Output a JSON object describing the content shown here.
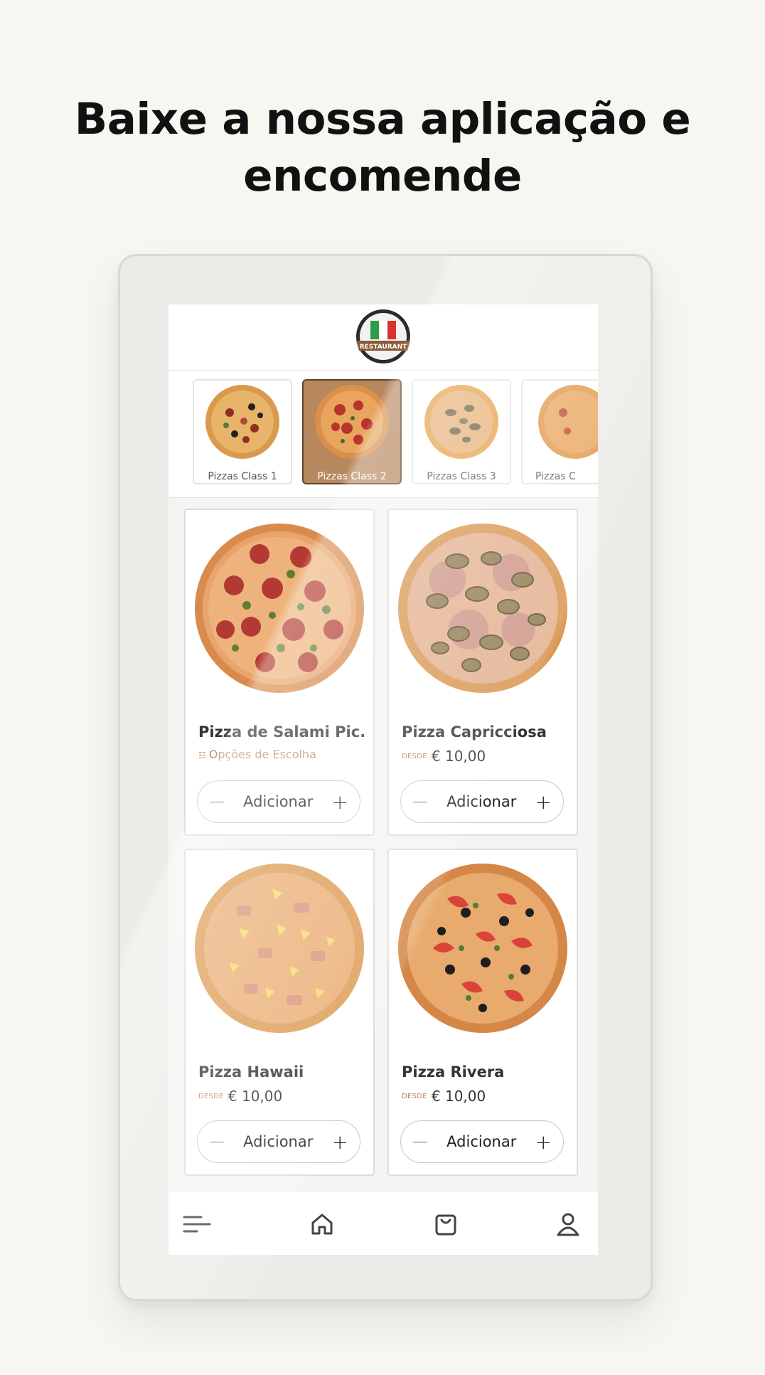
{
  "headline": {
    "line1": "Baixe a nossa aplicação e",
    "line2": "encomende"
  },
  "app": {
    "logo_text": "RESTAURANT",
    "categories": [
      {
        "label": "Pizzas Class 1",
        "active": false
      },
      {
        "label": "Pizzas Class 2",
        "active": true
      },
      {
        "label": "Pizzas Class 3",
        "active": false
      },
      {
        "label": "Pizzas C",
        "active": false
      }
    ],
    "products": [
      {
        "name": "Pizza de Salami Pic...",
        "options_label": "Opções de Escolha",
        "add_label": "Adicionar"
      },
      {
        "name": "Pizza Capricciosa",
        "desde": "DESDE",
        "price": "€ 10,00",
        "add_label": "Adicionar"
      },
      {
        "name": "Pizza Hawaii",
        "desde": "DESDE",
        "price": "€ 10,00",
        "add_label": "Adicionar"
      },
      {
        "name": "Pizza Rivera",
        "desde": "DESDE",
        "price": "€ 10,00",
        "add_label": "Adicionar"
      }
    ],
    "nav": {
      "icons": [
        "menu-icon",
        "home-icon",
        "bag-icon",
        "user-icon"
      ]
    }
  },
  "colors": {
    "accent": "#b7875e",
    "accent_text": "#c1805a",
    "page_bg": "#f8f6f1"
  }
}
